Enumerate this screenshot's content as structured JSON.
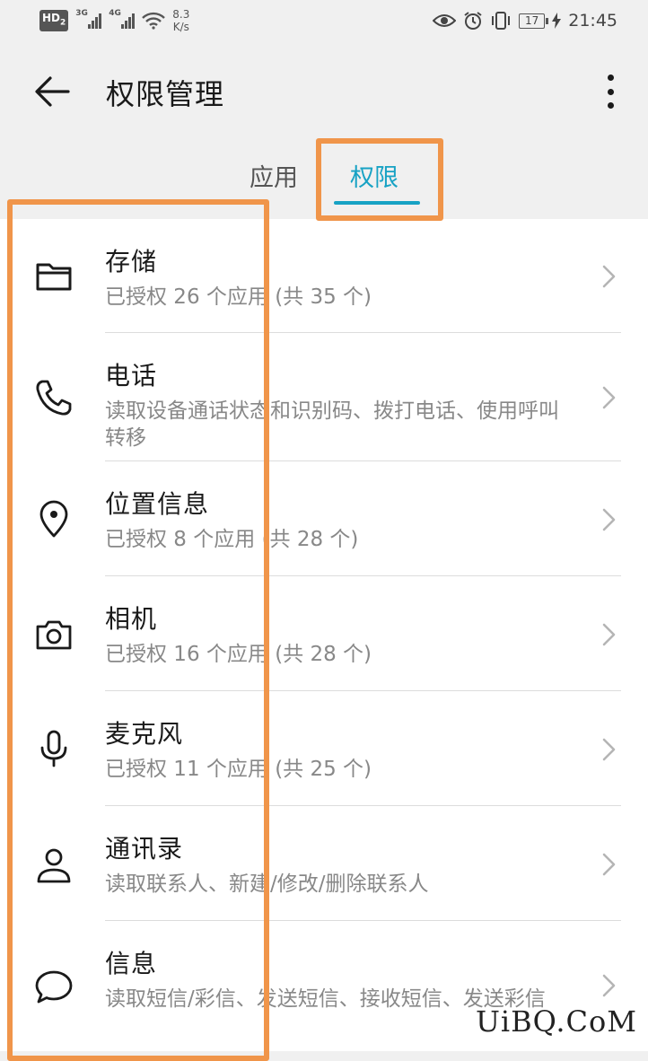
{
  "status_bar": {
    "hd_badge": "HD",
    "hd_sub": "2",
    "signal1_tag": "3G",
    "signal2_tag": "4G",
    "speed_value": "8.3",
    "speed_unit": "K/s",
    "battery": "17",
    "time": "21:45"
  },
  "app_bar": {
    "title": "权限管理",
    "back_icon": "arrow-left-icon",
    "more_icon": "more-vertical-icon"
  },
  "tabs": [
    {
      "label": "应用",
      "active": false
    },
    {
      "label": "权限",
      "active": true
    }
  ],
  "accent_color": "#17a2c4",
  "highlight_color": "#f0954a",
  "permissions": [
    {
      "icon": "folder-icon",
      "title": "存储",
      "subtitle": "已授权 26 个应用 (共 35 个)"
    },
    {
      "icon": "phone-icon",
      "title": "电话",
      "subtitle": "读取设备通话状态和识别码、拨打电话、使用呼叫转移"
    },
    {
      "icon": "location-pin-icon",
      "title": "位置信息",
      "subtitle": "已授权 8 个应用 (共 28 个)"
    },
    {
      "icon": "camera-icon",
      "title": "相机",
      "subtitle": "已授权 16 个应用 (共 28 个)"
    },
    {
      "icon": "microphone-icon",
      "title": "麦克风",
      "subtitle": "已授权 11 个应用 (共 25 个)"
    },
    {
      "icon": "contact-person-icon",
      "title": "通讯录",
      "subtitle": "读取联系人、新建/修改/删除联系人"
    },
    {
      "icon": "message-bubble-icon",
      "title": "信息",
      "subtitle": "读取短信/彩信、发送短信、接收短信、发送彩信"
    }
  ],
  "watermark": "UiBQ.CoM"
}
